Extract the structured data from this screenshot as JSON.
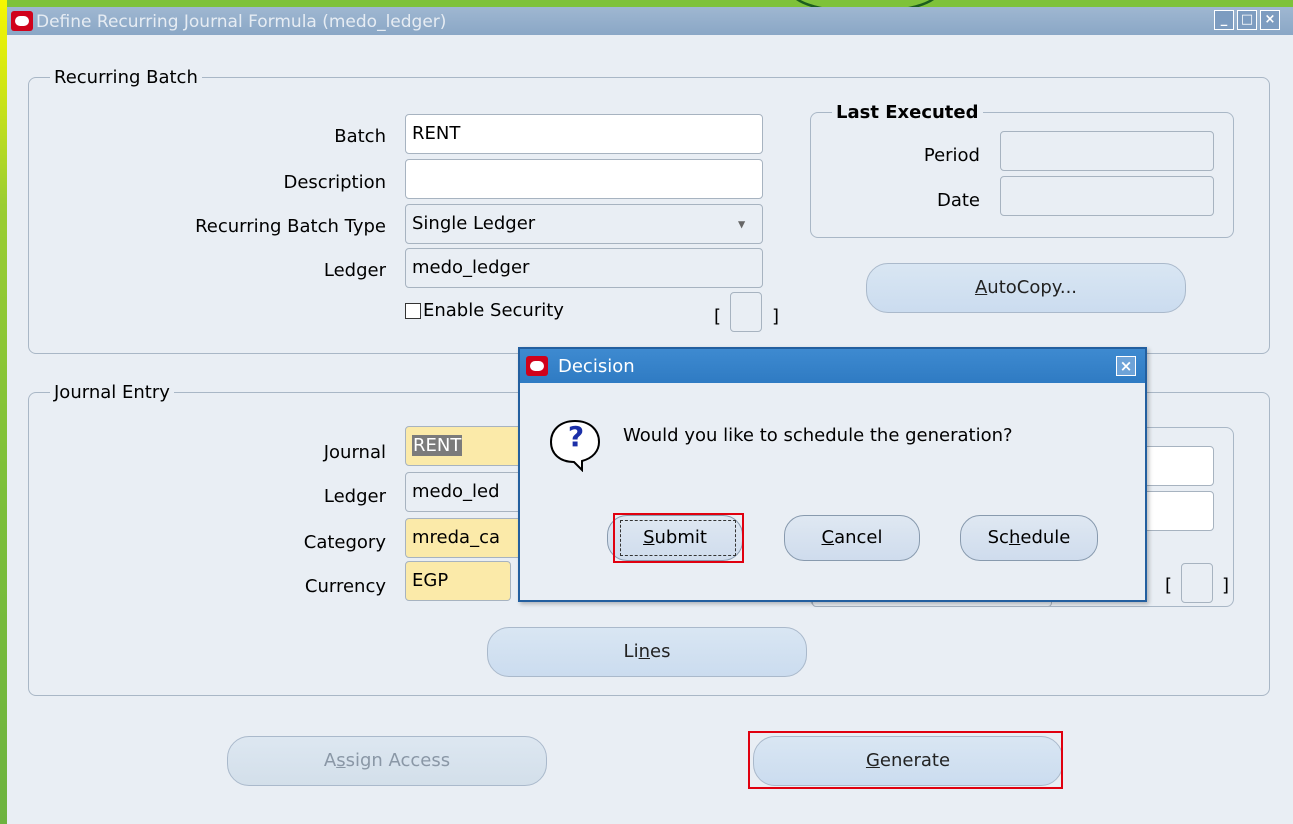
{
  "window": {
    "title": "Define Recurring Journal Formula (medo_ledger)",
    "controls": [
      "_",
      "□",
      "×"
    ]
  },
  "recurring_batch": {
    "group_title": "Recurring Batch",
    "batch_label": "Batch",
    "batch_value": "RENT",
    "description_label": "Description",
    "description_value": "",
    "type_label": "Recurring Batch Type",
    "type_value": "Single Ledger",
    "ledger_label": "Ledger",
    "ledger_value": "medo_ledger",
    "enable_security_label": "Enable Security",
    "enable_security_checked": false,
    "bracket_left": "[",
    "bracket_right": "]"
  },
  "last_executed": {
    "group_title": "Last Executed",
    "period_label": "Period",
    "period_value": "",
    "date_label": "Date",
    "date_value": ""
  },
  "autocopy_button": {
    "prefix": "",
    "accel": "A",
    "rest": "utoCopy..."
  },
  "journal_entry": {
    "group_title": "Journal Entry",
    "journal_label": "Journal",
    "journal_value": "RENT",
    "ledger_label": "Ledger",
    "ledger_value": "medo_led",
    "category_label": "Category",
    "category_value": "mreda_ca",
    "currency_label": "Currency",
    "currency_value": "EGP",
    "bracket_left": "[",
    "bracket_right": "]"
  },
  "lines_button": {
    "prefix": "Li",
    "accel": "n",
    "rest": "es"
  },
  "assign_access_button": {
    "prefix": "A",
    "accel": "s",
    "rest": "sign Access"
  },
  "generate_button": {
    "prefix": "",
    "accel": "G",
    "rest": "enerate"
  },
  "dialog": {
    "title": "Decision",
    "message": "Would you like to schedule the generation?",
    "question_glyph": "?",
    "close_glyph": "×",
    "submit": {
      "prefix": "",
      "accel": "S",
      "rest": "ubmit"
    },
    "cancel": {
      "prefix": "",
      "accel": "C",
      "rest": "ancel"
    },
    "schedule": {
      "prefix": "Sc",
      "accel": "h",
      "rest": "edule"
    }
  },
  "colors": {
    "dialog_title_bar": "#2f7bc3",
    "window_title_bar": "#8aa7c6",
    "required_field": "#fbeaa9",
    "highlight_box": "#e0000f",
    "oracle_red": "#d0021b"
  }
}
